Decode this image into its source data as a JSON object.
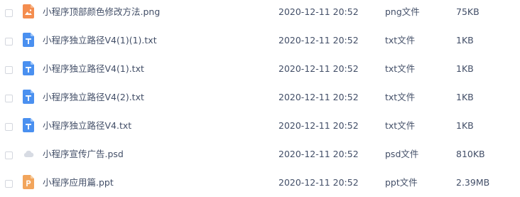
{
  "colors": {
    "text": "#424e67",
    "png_icon": "#f48d4f",
    "txt_icon": "#4a90f0",
    "psd_icon": "#d7dbe3",
    "ppt_icon": "#f2a55c",
    "checkbox_border": "#d4d7de"
  },
  "files": [
    {
      "name": "小程序顶部颜色修改方法.png",
      "date": "2020-12-11 20:52",
      "type": "png文件",
      "size": "75KB",
      "icon": "image-file-icon"
    },
    {
      "name": "小程序独立路径V4(1)(1).txt",
      "date": "2020-12-11 20:52",
      "type": "txt文件",
      "size": "1KB",
      "icon": "text-file-icon"
    },
    {
      "name": "小程序独立路径V4(1).txt",
      "date": "2020-12-11 20:52",
      "type": "txt文件",
      "size": "1KB",
      "icon": "text-file-icon"
    },
    {
      "name": "小程序独立路径V4(2).txt",
      "date": "2020-12-11 20:52",
      "type": "txt文件",
      "size": "1KB",
      "icon": "text-file-icon"
    },
    {
      "name": "小程序独立路径V4.txt",
      "date": "2020-12-11 20:52",
      "type": "txt文件",
      "size": "1KB",
      "icon": "text-file-icon"
    },
    {
      "name": "小程序宣传广告.psd",
      "date": "2020-12-11 20:52",
      "type": "psd文件",
      "size": "810KB",
      "icon": "psd-file-icon"
    },
    {
      "name": "小程序应用篇.ppt",
      "date": "2020-12-11 20:52",
      "type": "ppt文件",
      "size": "2.39MB",
      "icon": "ppt-file-icon"
    }
  ]
}
